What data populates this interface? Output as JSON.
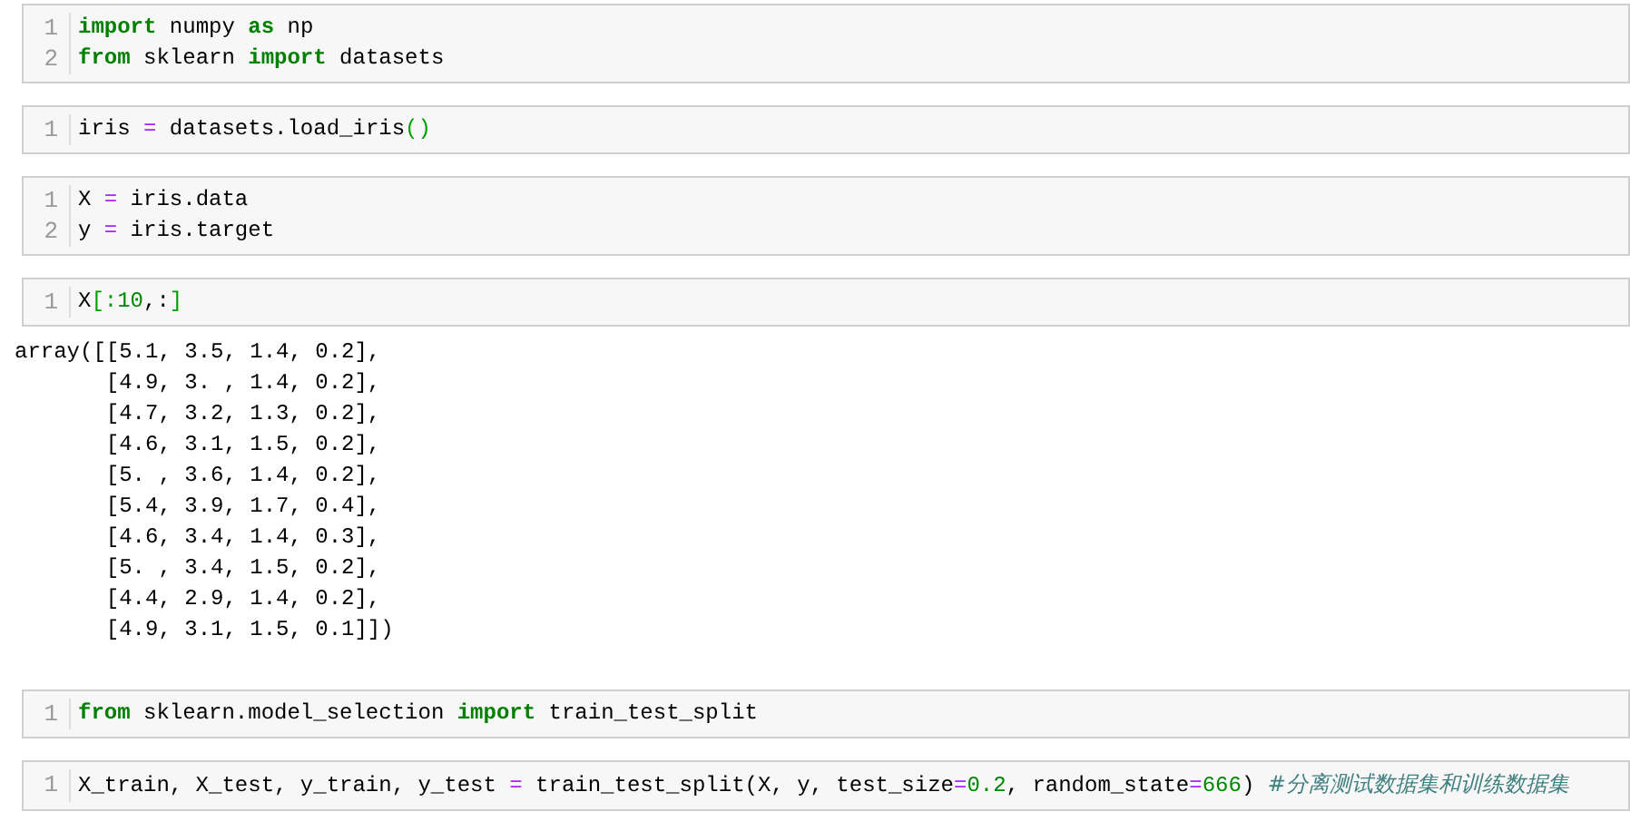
{
  "cells": [
    {
      "lines": [
        {
          "number": "1",
          "tokens": [
            {
              "kind": "keyword",
              "text": "import"
            },
            {
              "kind": "plain",
              "text": " numpy "
            },
            {
              "kind": "keyword",
              "text": "as"
            },
            {
              "kind": "plain",
              "text": " np"
            }
          ]
        },
        {
          "number": "2",
          "tokens": [
            {
              "kind": "keyword",
              "text": "from"
            },
            {
              "kind": "plain",
              "text": " sklearn "
            },
            {
              "kind": "keyword",
              "text": "import"
            },
            {
              "kind": "plain",
              "text": " datasets"
            }
          ]
        }
      ]
    },
    {
      "lines": [
        {
          "number": "1",
          "tokens": [
            {
              "kind": "plain",
              "text": "iris "
            },
            {
              "kind": "operator",
              "text": "="
            },
            {
              "kind": "plain",
              "text": " datasets.load_iris"
            },
            {
              "kind": "bracket",
              "text": "()"
            }
          ]
        }
      ]
    },
    {
      "lines": [
        {
          "number": "1",
          "tokens": [
            {
              "kind": "plain",
              "text": "X "
            },
            {
              "kind": "operator",
              "text": "="
            },
            {
              "kind": "plain",
              "text": " iris.data"
            }
          ]
        },
        {
          "number": "2",
          "tokens": [
            {
              "kind": "plain",
              "text": "y "
            },
            {
              "kind": "operator",
              "text": "="
            },
            {
              "kind": "plain",
              "text": " iris.target"
            }
          ]
        }
      ]
    },
    {
      "lines": [
        {
          "number": "1",
          "tokens": [
            {
              "kind": "plain",
              "text": "X"
            },
            {
              "kind": "bracket",
              "text": "[:"
            },
            {
              "kind": "number",
              "text": "10"
            },
            {
              "kind": "plain",
              "text": ",:"
            },
            {
              "kind": "bracket",
              "text": "]"
            }
          ]
        }
      ],
      "output": [
        "array([[5.1, 3.5, 1.4, 0.2],",
        "       [4.9, 3. , 1.4, 0.2],",
        "       [4.7, 3.2, 1.3, 0.2],",
        "       [4.6, 3.1, 1.5, 0.2],",
        "       [5. , 3.6, 1.4, 0.2],",
        "       [5.4, 3.9, 1.7, 0.4],",
        "       [4.6, 3.4, 1.4, 0.3],",
        "       [5. , 3.4, 1.5, 0.2],",
        "       [4.4, 2.9, 1.4, 0.2],",
        "       [4.9, 3.1, 1.5, 0.1]])"
      ]
    },
    {
      "lines": [
        {
          "number": "1",
          "tokens": [
            {
              "kind": "keyword",
              "text": "from"
            },
            {
              "kind": "plain",
              "text": " sklearn.model_selection "
            },
            {
              "kind": "keyword",
              "text": "import"
            },
            {
              "kind": "plain",
              "text": " train_test_split"
            }
          ]
        }
      ]
    },
    {
      "lines": [
        {
          "number": "1",
          "tokens": [
            {
              "kind": "plain",
              "text": "X_train, X_test, y_train, y_test "
            },
            {
              "kind": "operator",
              "text": "="
            },
            {
              "kind": "plain",
              "text": " train_test_split(X, y, test_size"
            },
            {
              "kind": "operator",
              "text": "="
            },
            {
              "kind": "number",
              "text": "0.2"
            },
            {
              "kind": "plain",
              "text": ", random_state"
            },
            {
              "kind": "operator",
              "text": "="
            },
            {
              "kind": "number",
              "text": "666"
            },
            {
              "kind": "plain",
              "text": ") "
            },
            {
              "kind": "comment",
              "text": "#分离测试数据集和训练数据集"
            }
          ]
        }
      ]
    }
  ]
}
